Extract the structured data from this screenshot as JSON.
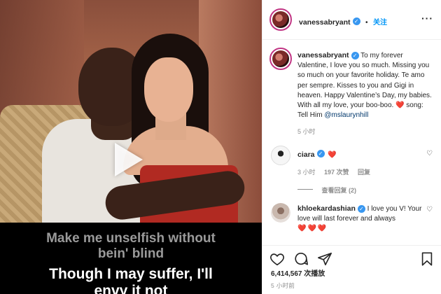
{
  "post": {
    "author": "vanessabryant",
    "follow_label": "关注",
    "caption_parts": {
      "author": "vanessabryant",
      "text": "To my forever Valentine, I love you so much. Missing you so much on your favorite holiday. Te amo per sempre. Kisses to you and Gigi in heaven. Happy Valentine’s Day, my babies. With all my love, your boo-boo.",
      "heart": "❤️",
      "song_prefix": "song: Tell Him",
      "mention": "@mslaurynhill"
    },
    "caption_time": "5 小时"
  },
  "comments": [
    {
      "user": "ciara",
      "text": "❤️",
      "time": "3 小时",
      "likes": "197 次赞",
      "reply_label": "回复",
      "view_replies": "查看回复 (2)"
    },
    {
      "user": "khloekardashian",
      "text": "I love you V! Your love will last forever and always",
      "hearts": "❤️❤️❤️"
    }
  ],
  "footer": {
    "plays": "6,414,567 次播放",
    "time": "5 小时前"
  },
  "media": {
    "lyric_dim": [
      "Make me unselfish without",
      "bein' blind"
    ],
    "lyric_bright": [
      "Though I may suffer, I'll",
      "envy it not"
    ]
  },
  "icons": [
    "play-icon",
    "verified-icon",
    "more-icon",
    "heart-icon",
    "comment-icon",
    "share-icon",
    "bookmark-icon"
  ]
}
